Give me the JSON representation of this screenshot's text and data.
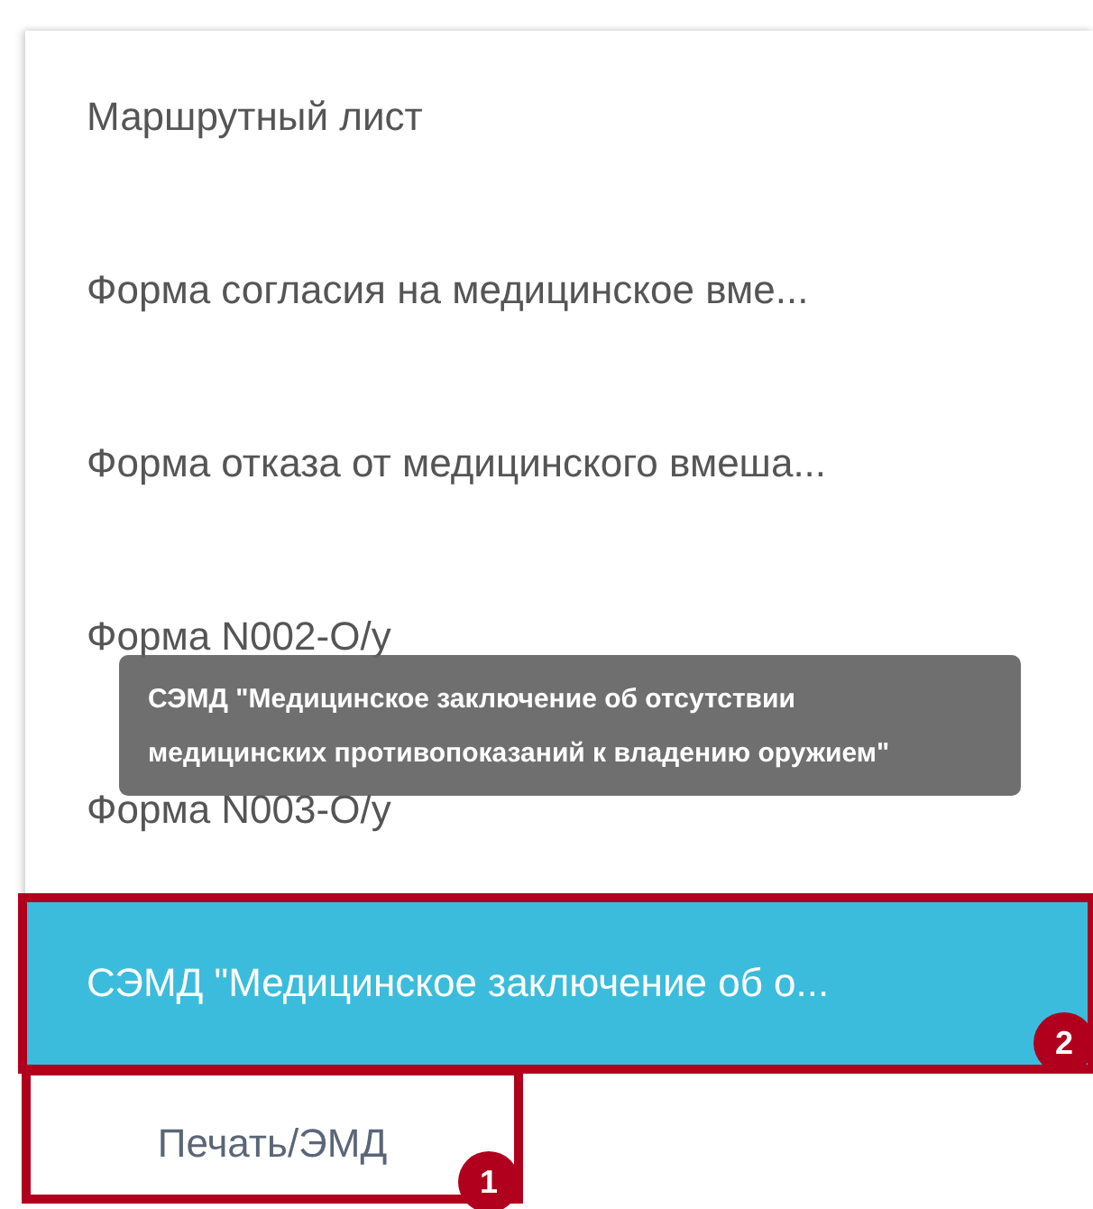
{
  "menu": {
    "items": [
      {
        "label": "Маршрутный лист",
        "selected": false
      },
      {
        "label": "Форма согласия на медицинское вме...",
        "selected": false
      },
      {
        "label": "Форма отказа от медицинского вмеша...",
        "selected": false
      },
      {
        "label": "Форма N002-O/y",
        "selected": false
      },
      {
        "label": "Форма N003-O/y",
        "selected": false
      },
      {
        "label": "СЭМД \"Медицинское заключение об о...",
        "selected": true,
        "annotation": "2"
      }
    ]
  },
  "tooltip": {
    "text": "СЭМД \"Медицинское заключение об отсутствии медицинских противопоказаний к владению оружием\""
  },
  "print_button": {
    "label": "Печать/ЭМД",
    "annotation": "1"
  }
}
